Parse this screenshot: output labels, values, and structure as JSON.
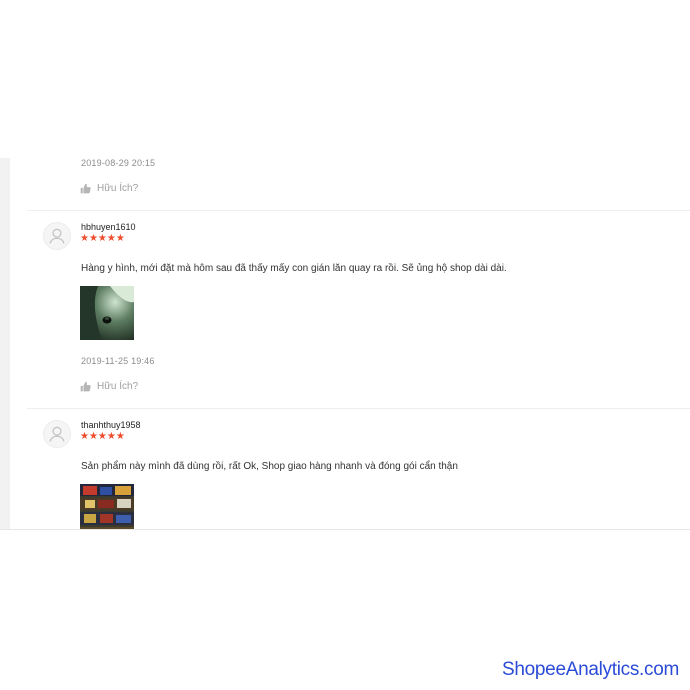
{
  "top_review": {
    "date": "2019-08-29 20:15",
    "helpful_label": "Hữu Ích?"
  },
  "reviews": [
    {
      "username": "hbhuyen1610",
      "stars": "★★★★★",
      "rating": 5,
      "comment": "Hàng y hình, mới đặt mà hôm sau đã thấy mấy con gián lăn quay ra rồi. Sẽ ủng hộ shop dài dài.",
      "date": "2019-11-25 19:46",
      "helpful_label": "Hữu Ích?"
    },
    {
      "username": "thanhthuy1958",
      "stars": "★★★★★",
      "rating": 5,
      "comment": "Sản phẩm này mình đã dùng rồi, rất Ok, Shop giao hàng nhanh và đóng gói cẩn thận"
    }
  ],
  "watermark": "ShopeeAnalytics.com",
  "colors": {
    "star": "#ee4d2d",
    "watermark": "#2b4bd8",
    "muted": "#8c8c8c"
  }
}
